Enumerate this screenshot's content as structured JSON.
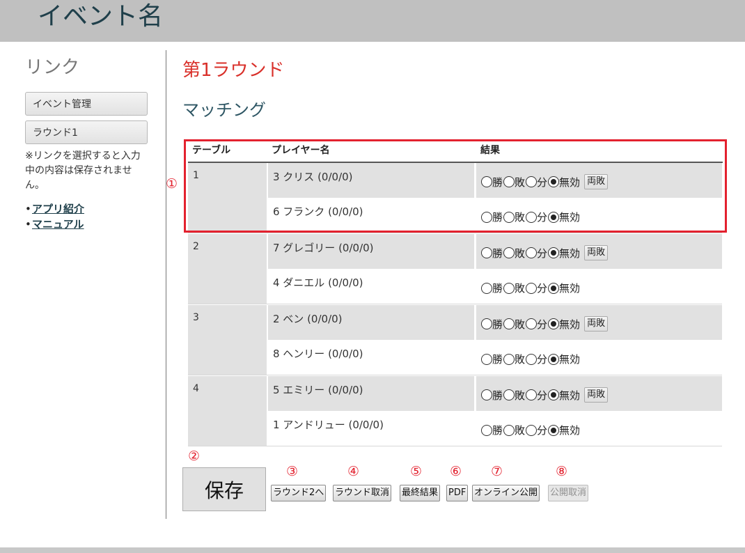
{
  "header": {
    "title": "イベント名"
  },
  "sidebar": {
    "heading": "リンク",
    "buttons": [
      "イベント管理",
      "ラウンド1"
    ],
    "note": "※リンクを選択すると入力中の内容は保存されません。",
    "links": [
      "アプリ紹介",
      "マニュアル"
    ]
  },
  "main": {
    "round_title": "第1ラウンド",
    "section_title": "マッチング",
    "table": {
      "headers": {
        "table": "テーブル",
        "player": "プレイヤー名",
        "result": "結果"
      },
      "groups": [
        {
          "table": "1",
          "players": [
            "3 クリス (0/0/0)",
            "6 フランク (0/0/0)"
          ]
        },
        {
          "table": "2",
          "players": [
            "7 グレゴリー (0/0/0)",
            "4 ダニエル (0/0/0)"
          ]
        },
        {
          "table": "3",
          "players": [
            "2 ベン (0/0/0)",
            "8 ヘンリー (0/0/0)"
          ]
        },
        {
          "table": "4",
          "players": [
            "5 エミリー (0/0/0)",
            "1 アンドリュー (0/0/0)"
          ]
        }
      ],
      "result_options": [
        "勝",
        "敗",
        "分",
        "無効"
      ],
      "selected_option": "無効",
      "both_lose_label": "両敗"
    },
    "actions": {
      "save": "保存",
      "next_round": "ラウンド2へ",
      "cancel_round": "ラウンド取消",
      "final_results": "最終結果",
      "pdf": "PDF",
      "publish_online": "オンライン公開",
      "unpublish": "公開取消"
    }
  },
  "annotations": {
    "markers": [
      "①",
      "②",
      "③",
      "④",
      "⑤",
      "⑥",
      "⑦",
      "⑧"
    ],
    "highlight_color": "#e3212e"
  }
}
